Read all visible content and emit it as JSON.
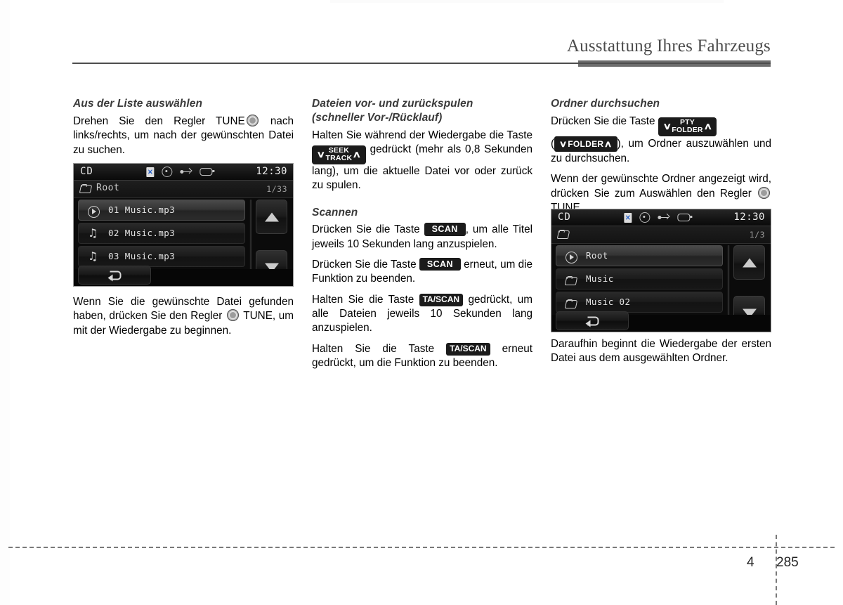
{
  "header": {
    "title": "Ausstattung Ihres Fahrzeugs"
  },
  "footer": {
    "chapter": "4",
    "page": "285"
  },
  "columns": {
    "left": {
      "heading": "Aus der Liste auswählen",
      "para1_a": "Drehen Sie den Regler TUNE",
      "para1_b": "nach links/rechts, um nach der gewünschten Datei zu suchen.",
      "caption_a": "Wenn Sie die gewünschte Datei gefunden haben, drücken Sie den Regler",
      "caption_b": "TUNE, um mit der Wiedergabe zu beginnen."
    },
    "middle": {
      "heading_line1": "Dateien vor- und zurückspulen",
      "heading_line2": "(schneller Vor-/Rücklauf)",
      "para_a": "Halten Sie während der Wiedergabe die Taste",
      "seek_key": {
        "down": "∨",
        "top": "SEEK",
        "bottom": "TRACK",
        "up": "∧"
      },
      "para_b": "gedrückt (mehr als 0,8 Sekunden lang), um die aktuelle Datei vor oder zurück zu spulen.",
      "scan_heading": "Scannen",
      "scan_p1_a": "Drücken Sie die Taste",
      "scan_key": "SCAN",
      "scan_p1_b": ", um alle Titel jeweils 10 Sekunden lang anzuspielen.",
      "scan_p2_a": "Drücken Sie die Taste",
      "scan_p2_b": "erneut, um die Funktion zu beenden.",
      "scan_p3_a": "Halten Sie die Taste",
      "tascan_key": "TA/SCAN",
      "scan_p3_b": "gedrückt, um alle Dateien jeweils 10 Sekunden lang anzuspielen.",
      "scan_p4_a": "Halten Sie die Taste",
      "scan_p4_b": "erneut gedrückt, um die Funktion zu beenden."
    },
    "right": {
      "heading": "Ordner durchsuchen",
      "para1_a": "Drücken Sie die Taste",
      "pty_key": {
        "down": "∨",
        "top": "PTY",
        "bottom": "FOLDER",
        "up": "∧"
      },
      "para1_b_open": "(",
      "folder_key": {
        "down": "∨",
        "label": "FOLDER",
        "up": "∧"
      },
      "para1_b_close": "), um Ordner auszuwählen und zu durchsuchen.",
      "para2_a": "Wenn der gewünschte Ordner angezeigt wird, drücken Sie zum Auswählen den Regler",
      "para2_b": "TUNE.",
      "caption": "Daraufhin beginnt die Wiedergabe der ersten Datei aus dem ausgewählten Ordner."
    }
  },
  "screens": [
    {
      "id": "screen1",
      "source": "CD",
      "clock": "12:30",
      "status_icons": [
        "bluetooth-icon",
        "disc-icon",
        "usb-icon",
        "aux-icon"
      ],
      "path_label": "Root",
      "path_count": "1/33",
      "rows": [
        {
          "icon": "play-icon",
          "label": "01 Music.mp3",
          "selected": true
        },
        {
          "icon": "music-note-icon",
          "label": "02 Music.mp3",
          "selected": false
        },
        {
          "icon": "music-note-icon",
          "label": "03 Music.mp3",
          "selected": false
        }
      ]
    },
    {
      "id": "screen2",
      "source": "CD",
      "clock": "12:30",
      "status_icons": [
        "bluetooth-icon",
        "disc-icon",
        "usb-icon",
        "aux-icon"
      ],
      "path_label": "",
      "path_count": "1/3",
      "rows": [
        {
          "icon": "play-icon",
          "label": "Root",
          "selected": true
        },
        {
          "icon": "folder-icon",
          "label": "Music",
          "selected": false
        },
        {
          "icon": "folder-icon",
          "label": "Music 02",
          "selected": false
        }
      ]
    }
  ],
  "colors": {
    "header_text": "#4b4b4b",
    "rule": "#4d4d4d",
    "rule_block": "#6d6d6d",
    "key_badge_bg": "#1b1b1b",
    "screen_bg": "#0b0b0b",
    "bluetooth_blue": "#2a63c9"
  }
}
